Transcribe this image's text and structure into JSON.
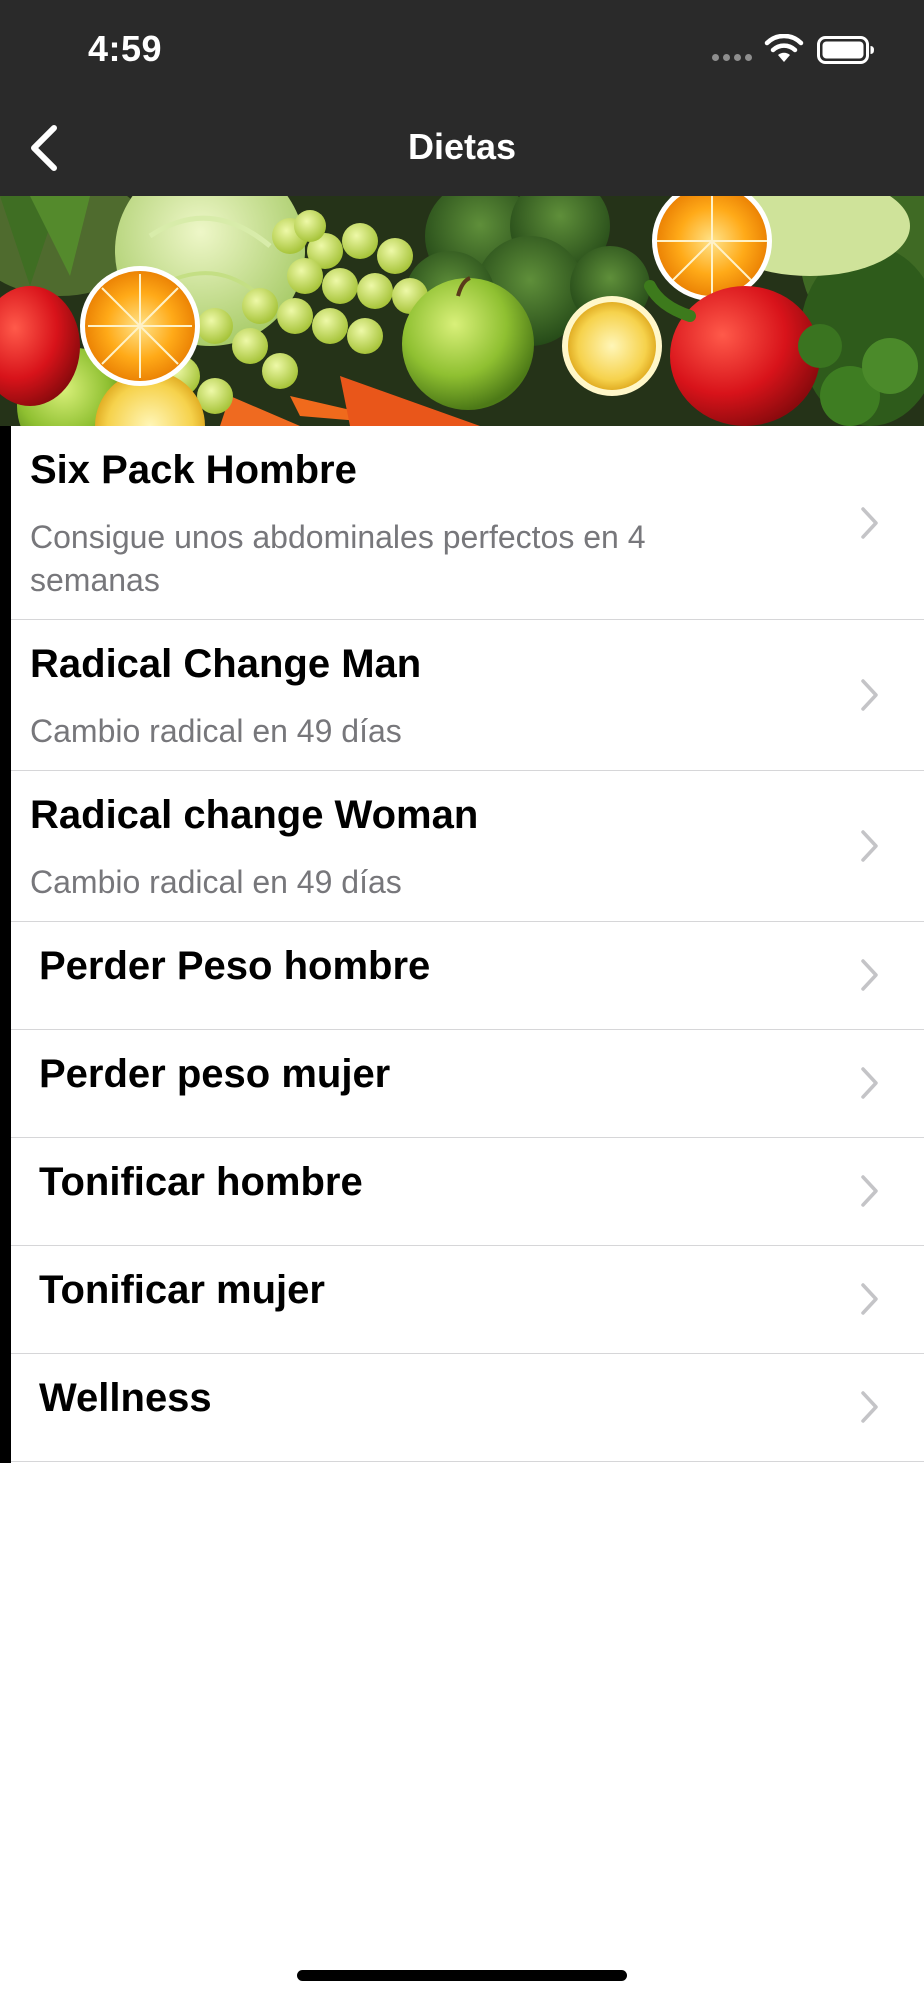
{
  "status_bar": {
    "time": "4:59",
    "icons": [
      "signal-dots-icon",
      "wifi-icon",
      "battery-icon"
    ]
  },
  "nav": {
    "back_icon": "chevron-left-icon",
    "title": "Dietas"
  },
  "hero": {
    "image": "vegetables-and-fruits-photo"
  },
  "diets": [
    {
      "title": "Six Pack Hombre",
      "subtitle": "Consigue unos abdominales perfectos en 4 semanas"
    },
    {
      "title": "Radical Change Man",
      "subtitle": "Cambio radical en 49 días"
    },
    {
      "title": "Radical change Woman",
      "subtitle": "Cambio radical en 49 días"
    },
    {
      "title": "Perder Peso hombre",
      "subtitle": ""
    },
    {
      "title": "Perder peso mujer",
      "subtitle": ""
    },
    {
      "title": "Tonificar hombre",
      "subtitle": ""
    },
    {
      "title": "Tonificar mujer",
      "subtitle": ""
    },
    {
      "title": "Wellness",
      "subtitle": ""
    }
  ],
  "colors": {
    "bar_background": "#2a2a2a",
    "accent": "#000000",
    "subtitle_text": "#77777b",
    "separator": "#d6d6d8",
    "chevron": "#c4c4c7"
  }
}
